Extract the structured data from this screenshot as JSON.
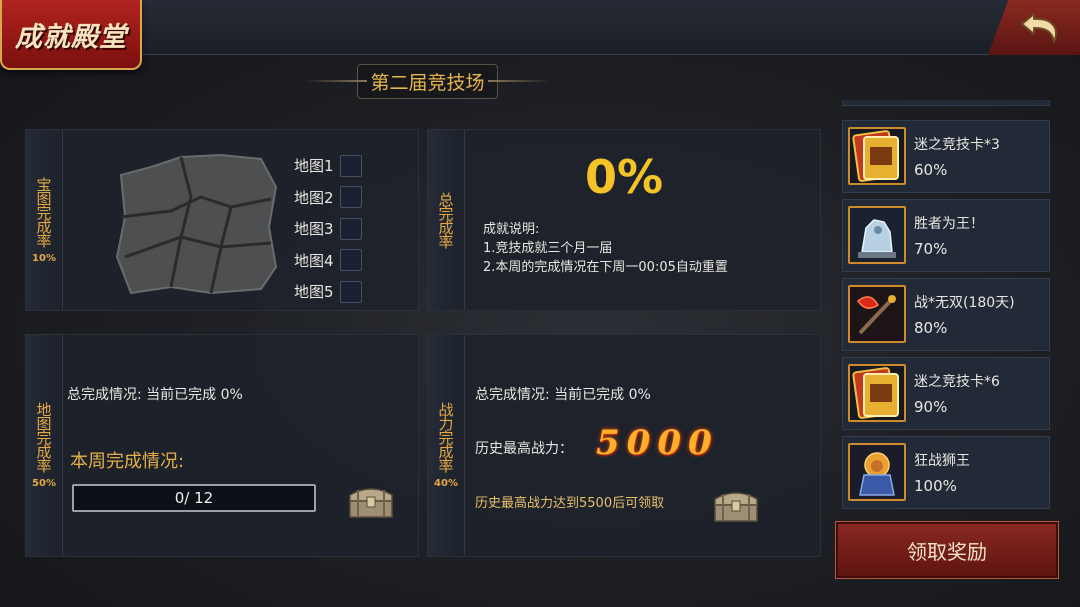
{
  "header": {
    "title": "成就殿堂",
    "back_icon": "back-arrow-icon"
  },
  "page_title": "第二届竞技场",
  "treasure_map_panel": {
    "label": "宝图完成率",
    "percent": "10%",
    "maps": [
      {
        "label": "地图1",
        "checked": false
      },
      {
        "label": "地图2",
        "checked": false
      },
      {
        "label": "地图3",
        "checked": false
      },
      {
        "label": "地图4",
        "checked": false
      },
      {
        "label": "地图5",
        "checked": false
      }
    ]
  },
  "total_panel": {
    "label": "总完成率",
    "percent": "0%",
    "desc_title": "成就说明:",
    "desc_line1": "1.竞技成就三个月一届",
    "desc_line2": "2.本周的完成情况在下周一00:05自动重置"
  },
  "map_completion_panel": {
    "label": "地图完成率",
    "percent": "50%",
    "total_status": "总完成情况: 当前已完成 0%",
    "week_title": "本周完成情况:",
    "progress_text": "0/ 12",
    "progress_fraction": 0
  },
  "power_panel": {
    "label": "战力完成率",
    "percent": "40%",
    "total_status": "总完成情况: 当前已完成 0%",
    "highest_label": "历史最高战力：",
    "highest_value": "5000",
    "note": "历史最高战力达到5500后可领取"
  },
  "rewards": [
    {
      "name": "迷之竞技卡*3",
      "percent": "60%",
      "icon": "card-pack-icon"
    },
    {
      "name": "胜者为王！",
      "percent": "70%",
      "icon": "wolf-statue-icon"
    },
    {
      "name": "战*无双(180天)",
      "percent": "80%",
      "icon": "battle-axe-icon"
    },
    {
      "name": "迷之竞技卡*6",
      "percent": "90%",
      "icon": "card-pack-icon"
    },
    {
      "name": "狂战狮王",
      "percent": "100%",
      "icon": "lion-king-icon"
    }
  ],
  "claim_button": "领取奖励",
  "colors": {
    "accent_gold": "#e4a843",
    "percent_yellow": "#f3c327",
    "button_red": "#8a2822"
  }
}
